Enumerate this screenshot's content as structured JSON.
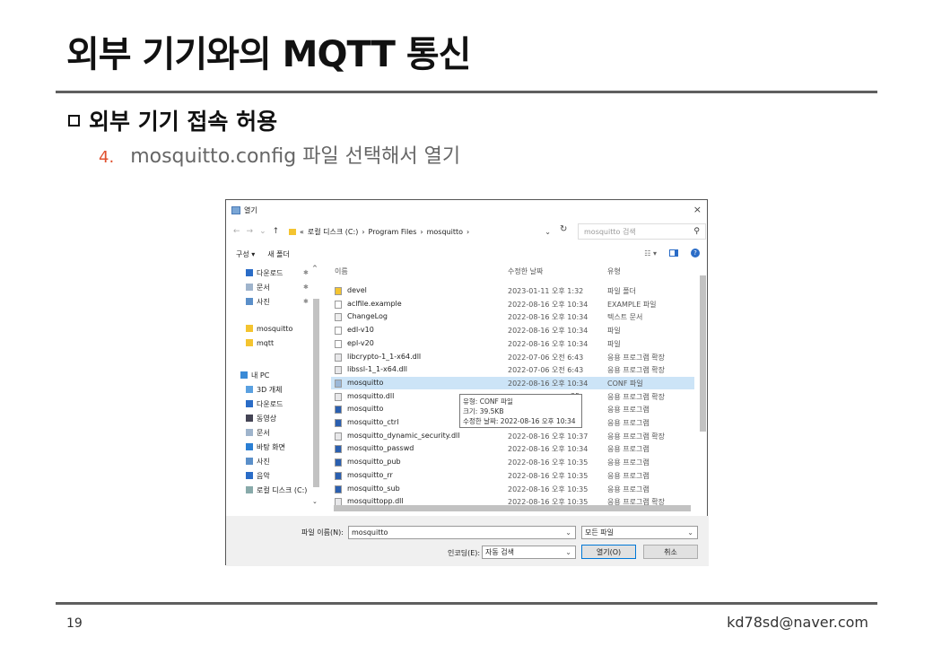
{
  "slide": {
    "title": "외부 기기와의 MQTT 통신",
    "heading": "외부 기기 접속 허용",
    "step_num": "4.",
    "step_text": "mosquitto.config 파일 선택해서 열기",
    "page_number": "19",
    "email": "kd78sd@naver.com"
  },
  "dialog": {
    "title": "열기",
    "close": "×",
    "nav": {
      "back": "←",
      "forward": "→",
      "recent": "⌄",
      "up": "↑"
    },
    "breadcrumb": [
      "로컬 디스크 (C:)",
      "Program Files",
      "mosquitto"
    ],
    "breadcrumb_sep": "›",
    "refresh": "↻",
    "search_placeholder": "mosquitto 검색",
    "search_icon": "magnifier-icon",
    "toolbar": {
      "organize": "구성 ▾",
      "new_folder": "새 폴더",
      "help": "?"
    },
    "sidebar": [
      {
        "label": "다운로드",
        "icon": "download-icon",
        "pinned": true
      },
      {
        "label": "문서",
        "icon": "document-icon",
        "pinned": true
      },
      {
        "label": "사진",
        "icon": "picture-icon",
        "pinned": true
      },
      {
        "label": "mosquitto",
        "icon": "folder-icon",
        "pinned": false
      },
      {
        "label": "mqtt",
        "icon": "folder-icon",
        "pinned": false
      },
      {
        "label": "내 PC",
        "icon": "pc-icon",
        "pinned": false
      },
      {
        "label": "3D 개체",
        "icon": "3d-icon",
        "pinned": false
      },
      {
        "label": "다운로드",
        "icon": "download-icon",
        "pinned": false
      },
      {
        "label": "동영상",
        "icon": "video-icon",
        "pinned": false
      },
      {
        "label": "문서",
        "icon": "document-icon",
        "pinned": false
      },
      {
        "label": "바탕 화면",
        "icon": "desktop-icon",
        "pinned": false
      },
      {
        "label": "사진",
        "icon": "picture-icon",
        "pinned": false
      },
      {
        "label": "음악",
        "icon": "music-icon",
        "pinned": false
      },
      {
        "label": "로컬 디스크 (C:)",
        "icon": "drive-icon",
        "pinned": false
      }
    ],
    "columns": {
      "name": "이름",
      "date": "수정한 날짜",
      "type": "유형"
    },
    "files": [
      {
        "name": "devel",
        "date": "2023-01-11 오후 1:32",
        "type": "파일 폴더",
        "icon": "folder-icon"
      },
      {
        "name": "aclfile.example",
        "date": "2022-08-16 오후 10:34",
        "type": "EXAMPLE 파일",
        "icon": "file-icon"
      },
      {
        "name": "ChangeLog",
        "date": "2022-08-16 오후 10:34",
        "type": "텍스트 문서",
        "icon": "text-file-icon"
      },
      {
        "name": "edl-v10",
        "date": "2022-08-16 오후 10:34",
        "type": "파일",
        "icon": "file-icon"
      },
      {
        "name": "epl-v20",
        "date": "2022-08-16 오후 10:34",
        "type": "파일",
        "icon": "file-icon"
      },
      {
        "name": "libcrypto-1_1-x64.dll",
        "date": "2022-07-06 오전 6:43",
        "type": "응용 프로그램 확장",
        "icon": "dll-icon"
      },
      {
        "name": "libssl-1_1-x64.dll",
        "date": "2022-07-06 오전 6:43",
        "type": "응용 프로그램 확장",
        "icon": "dll-icon"
      },
      {
        "name": "mosquitto",
        "date": "2022-08-16 오후 10:34",
        "type": "CONF 파일",
        "icon": "conf-file-icon",
        "selected": true
      },
      {
        "name": "mosquitto.dll",
        "date": "35",
        "type": "응용 프로그램 확장",
        "icon": "dll-icon"
      },
      {
        "name": "mosquitto",
        "date": "41",
        "type": "응용 프로그램",
        "icon": "exe-icon"
      },
      {
        "name": "mosquitto_ctrl",
        "date": "35",
        "type": "응용 프로그램",
        "icon": "exe-icon"
      },
      {
        "name": "mosquitto_dynamic_security.dll",
        "date": "2022-08-16 오후 10:37",
        "type": "응용 프로그램 확장",
        "icon": "dll-icon"
      },
      {
        "name": "mosquitto_passwd",
        "date": "2022-08-16 오후 10:34",
        "type": "응용 프로그램",
        "icon": "exe-icon"
      },
      {
        "name": "mosquitto_pub",
        "date": "2022-08-16 오후 10:35",
        "type": "응용 프로그램",
        "icon": "exe-icon"
      },
      {
        "name": "mosquitto_rr",
        "date": "2022-08-16 오후 10:35",
        "type": "응용 프로그램",
        "icon": "exe-icon"
      },
      {
        "name": "mosquitto_sub",
        "date": "2022-08-16 오후 10:35",
        "type": "응용 프로그램",
        "icon": "exe-icon"
      },
      {
        "name": "mosquittopp.dll",
        "date": "2022-08-16 오후 10:35",
        "type": "응용 프로그램 확장",
        "icon": "dll-icon"
      }
    ],
    "tooltip": [
      "유형: CONF 파일",
      "크기: 39.5KB",
      "수정한 날짜: 2022-08-16 오후 10:34"
    ],
    "filename_label": "파일 이름(N):",
    "filename_value": "mosquitto",
    "filter_value": "모든 파일",
    "encoding_label": "인코딩(E):",
    "encoding_value": "자동 검색",
    "open_button": "열기(O)",
    "cancel_button": "취소"
  }
}
